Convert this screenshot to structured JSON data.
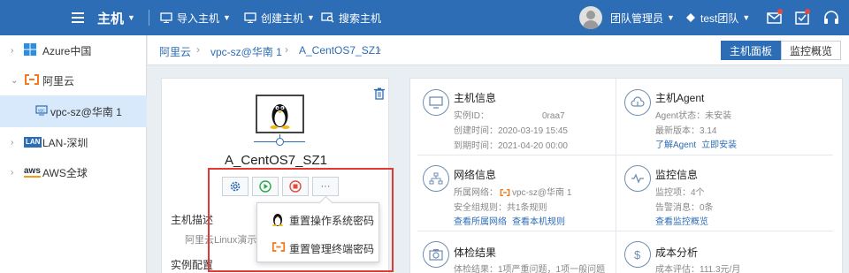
{
  "topbar": {
    "brand": "主机",
    "nav": [
      {
        "label": "导入主机",
        "has_caret": true
      },
      {
        "label": "创建主机",
        "has_caret": true
      },
      {
        "label": "搜索主机",
        "has_caret": false
      }
    ],
    "user_role": "团队管理员",
    "team": "test团队",
    "colors": {
      "bar": "#2d6db5",
      "badge": "#e24a3b"
    }
  },
  "sidebar": {
    "items": [
      {
        "label": "Azure中国",
        "icon": "windows-icon",
        "expanded": false
      },
      {
        "label": "阿里云",
        "icon": "alicloud-icon",
        "expanded": true
      },
      {
        "label": "vpc-sz@华南 1",
        "icon": "vpc-icon",
        "selected": true
      },
      {
        "label": "LAN-深圳",
        "icon": "lan-icon",
        "expanded": false
      },
      {
        "label": "AWS全球",
        "icon": "aws-icon",
        "expanded": false
      }
    ],
    "lan_badge": "LAN",
    "aws_badge": "aws"
  },
  "breadcrumb": {
    "items": [
      "阿里云",
      "vpc-sz@华南 1",
      "A_CentOS7_SZ1"
    ],
    "tabs": [
      {
        "label": "主机面板",
        "active": true
      },
      {
        "label": "监控概览",
        "active": false
      }
    ]
  },
  "host": {
    "name": "A_CentOS7_SZ1",
    "actions": [
      {
        "icon": "gear-icon"
      },
      {
        "icon": "play-icon"
      },
      {
        "icon": "stop-icon"
      },
      {
        "label": "···"
      }
    ],
    "description_label": "主机描述",
    "description_text": "阿里云Linux演示主",
    "config_label": "实例配置"
  },
  "dropdown": {
    "items": [
      {
        "label": "重置操作系统密码",
        "icon": "linux-icon"
      },
      {
        "label": "重置管理终端密码",
        "icon": "alicloud-icon"
      }
    ]
  },
  "info": {
    "host_info": {
      "title": "主机信息",
      "instance_id_label": "实例ID：",
      "instance_id_value": "0raa7",
      "created_label": "创建时间：",
      "created_value": "2020-03-19 15:45",
      "expire_label": "到期时间：",
      "expire_value": "2021-04-20 00:00"
    },
    "agent": {
      "title": "主机Agent",
      "status_label": "Agent状态：",
      "status_value": "未安装",
      "version_label": "最新版本：",
      "version_value": "3.14",
      "link_learn": "了解Agent",
      "link_install": "立即安装"
    },
    "network": {
      "title": "网络信息",
      "network_label": "所属网络：",
      "network_value": "vpc-sz@华南 1",
      "security_label": "安全组规则：",
      "security_value": "共1条规则",
      "link_network": "查看所属网络",
      "link_rules": "查看本机规则"
    },
    "monitor": {
      "title": "监控信息",
      "items_label": "监控项：",
      "items_value": "4个",
      "alerts_label": "告警消息：",
      "alerts_value": "0条",
      "link": "查看监控概览"
    },
    "health": {
      "title": "体检结果",
      "result_label": "体检结果：",
      "result_value": "1项严重问题，1项一般问题"
    },
    "cost": {
      "title": "成本分析",
      "estimate_label": "成本评估：",
      "estimate_value": "111.3元/月"
    }
  }
}
